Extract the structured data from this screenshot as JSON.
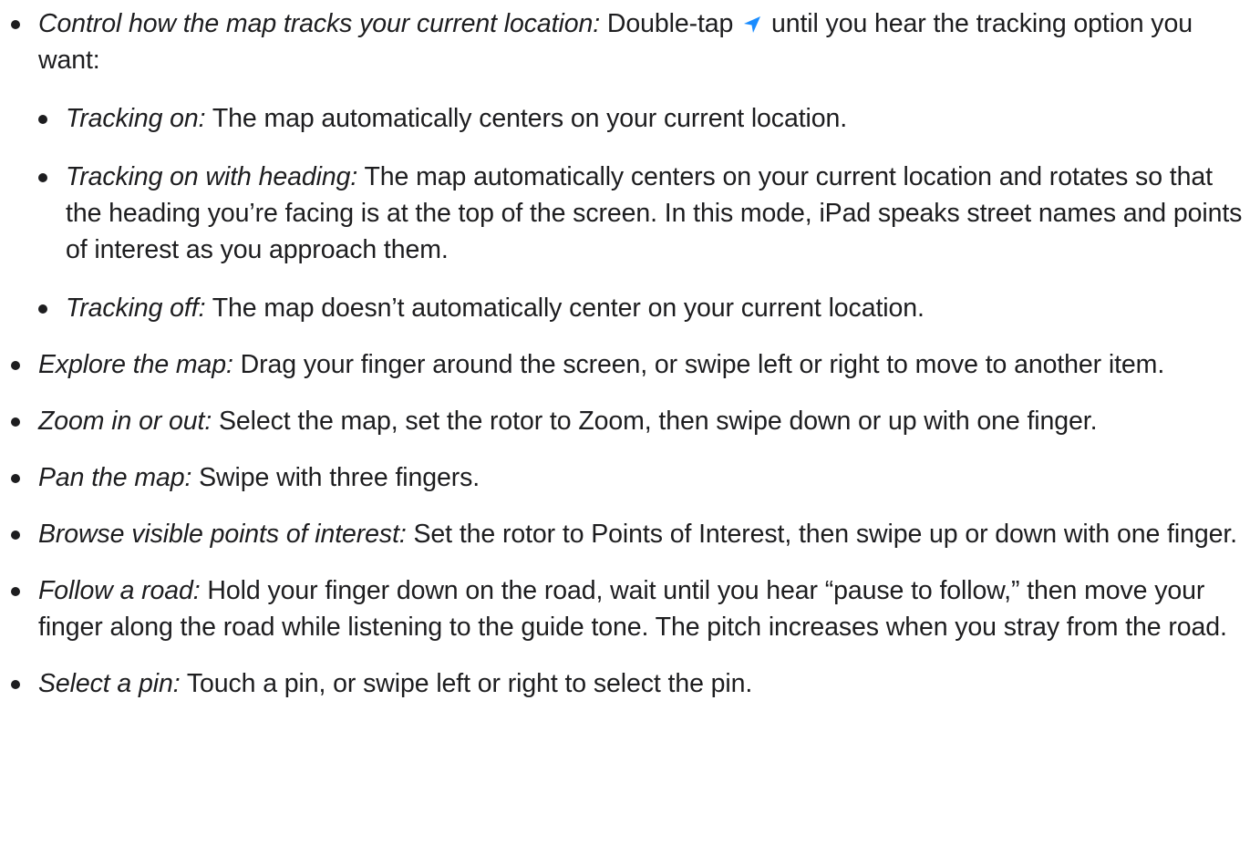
{
  "icon_color": "#1a8cff",
  "text_color": "#1d1d1f",
  "items": [
    {
      "term": "Control how the map tracks your current location:",
      "before_icon": " Double-tap ",
      "icon": "location-arrow-icon",
      "after_icon": " until you hear the tracking option you want:",
      "subitems": [
        {
          "term": "Tracking on:",
          "text": " The map automatically centers on your current location."
        },
        {
          "term": "Tracking on with heading:",
          "text": " The map automatically centers on your current location and rotates so that the heading you’re facing is at the top of the screen. In this mode, iPad speaks street names and points of interest as you approach them."
        },
        {
          "term": "Tracking off:",
          "text": " The map doesn’t automatically center on your current location."
        }
      ]
    },
    {
      "term": "Explore the map:",
      "text": " Drag your finger around the screen, or swipe left or right to move to another item."
    },
    {
      "term": "Zoom in or out:",
      "text": " Select the map, set the rotor to Zoom, then swipe down or up with one finger."
    },
    {
      "term": "Pan the map:",
      "text": " Swipe with three fingers."
    },
    {
      "term": "Browse visible points of interest:",
      "text": " Set the rotor to Points of Interest, then swipe up or down with one finger."
    },
    {
      "term": "Follow a road:",
      "text": " Hold your finger down on the road, wait until you hear “pause to follow,” then move your finger along the road while listening to the guide tone. The pitch increases when you stray from the road."
    },
    {
      "term": "Select a pin:",
      "text": " Touch a pin, or swipe left or right to select the pin."
    }
  ]
}
